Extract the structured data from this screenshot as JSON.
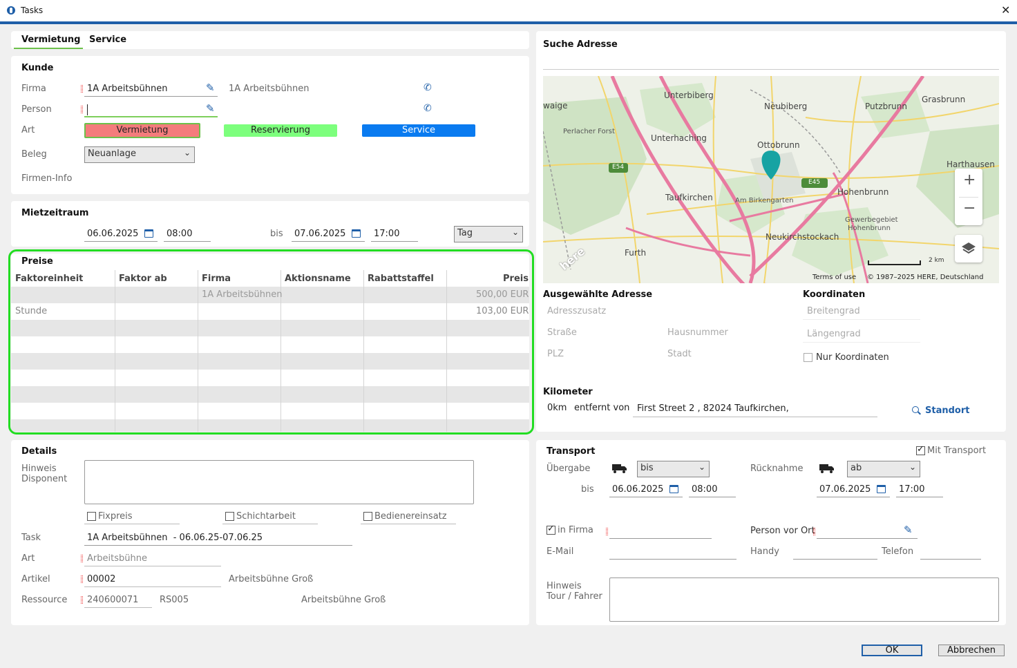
{
  "window": {
    "title": "Tasks",
    "close": "✕"
  },
  "tabs": [
    {
      "label": "Vermietung"
    },
    {
      "label": "Service"
    }
  ],
  "kunde": {
    "heading": "Kunde",
    "firma_label": "Firma",
    "firma_value": "1A Arbeitsbühnen",
    "firma_display": "1A Arbeitsbühnen",
    "person_label": "Person",
    "person_value": "",
    "art_label": "Art",
    "art_buttons": [
      "Vermietung",
      "Reservierung",
      "Service"
    ],
    "beleg_label": "Beleg",
    "beleg_value": "Neuanlage",
    "firmeninfo_label": "Firmen-Info"
  },
  "mietzeitraum": {
    "heading": "Mietzeitraum",
    "from_date": "06.06.2025",
    "from_time": "08:00",
    "bis_label": "bis",
    "to_date": "07.06.2025",
    "to_time": "17:00",
    "unit": "Tag"
  },
  "preise": {
    "heading": "Preise",
    "columns": [
      "Faktoreinheit",
      "Faktor ab",
      "Firma",
      "Aktionsname",
      "Rabattstaffel",
      "Preis"
    ],
    "rows": [
      [
        "",
        "",
        "1A Arbeitsbühnen",
        "",
        "",
        "500,00 EUR"
      ],
      [
        "Stunde",
        "",
        "",
        "",
        "",
        "103,00 EUR"
      ]
    ]
  },
  "details": {
    "heading": "Details",
    "hinweis_label": "Hinweis\nDisponent",
    "hinweis_line1": "Hinweis",
    "hinweis_line2": "Disponent",
    "fixpreis": "Fixpreis",
    "schichtarbeit": "Schichtarbeit",
    "bedienereinsatz": "Bedienereinsatz",
    "task_label": "Task",
    "task_value": "1A Arbeitsbühnen  - 06.06.25-07.06.25",
    "art_label": "Art",
    "art_placeholder": "Arbeitsbühne",
    "artikel_label": "Artikel",
    "artikel_value": "00002",
    "artikel_name": "Arbeitsbühne Groß",
    "ressource_label": "Ressource",
    "ressource_value": "240600071",
    "ressource_code": "RS005",
    "ressource_name": "Arbeitsbühne Groß"
  },
  "suche": {
    "heading": "Suche Adresse",
    "map_labels": [
      "Unterbiberg",
      "Neubiberg",
      "Putzbrunn",
      "Grasbrunn",
      "waige",
      "Perlacher Forst",
      "Unterhaching",
      "Ottobrunn",
      "Harthausen",
      "E54",
      "E45",
      "Hohenbrunn",
      "Taufkirchen",
      "Am Birkengarten",
      "Gewerbegebiet",
      "Hohenbrunn",
      "Neukirchstockach",
      "Furth",
      "here",
      "2 km"
    ],
    "terms": "Terms of use",
    "copyright": "© 1987–2025 HERE, Deutschland",
    "zoom_in": "+",
    "zoom_out": "−"
  },
  "adresse": {
    "heading": "Ausgewählte Adresse",
    "adresszusatz": "Adresszusatz",
    "strasse": "Straße",
    "hausnummer": "Hausnummer",
    "plz": "PLZ",
    "stadt": "Stadt",
    "koordinaten_heading": "Koordinaten",
    "breitengrad": "Breitengrad",
    "laengengrad": "Längengrad",
    "nur_koordinaten": "Nur Koordinaten"
  },
  "kilometer": {
    "heading": "Kilometer",
    "km": "0km",
    "entfernt": "entfernt von",
    "address": "First Street 2 , 82024 Taufkirchen,",
    "standort": "Standort"
  },
  "transport": {
    "heading": "Transport",
    "mit_transport": "Mit Transport",
    "uebergabe": "Übergabe",
    "uebergabe_sel": "bis",
    "ruecknahme": "Rücknahme",
    "ruecknahme_sel": "ab",
    "bis_label": "bis",
    "from_date": "06.06.2025",
    "from_time": "08:00",
    "to_date": "07.06.2025",
    "to_time": "17:00",
    "in_firma": "in Firma",
    "person_vor_ort": "Person vor Ort",
    "email": "E-Mail",
    "handy": "Handy",
    "telefon": "Telefon",
    "hinweis_line1": "Hinweis",
    "hinweis_line2": "Tour / Fahrer"
  },
  "footer": {
    "ok": "OK",
    "abbrechen": "Abbrechen"
  },
  "colors": {
    "accent": "#1f5fa8",
    "highlight_green": "#22dd22",
    "vermietung": "#f47c7c",
    "reservierung": "#7dff7d",
    "service": "#0a7bf0"
  }
}
